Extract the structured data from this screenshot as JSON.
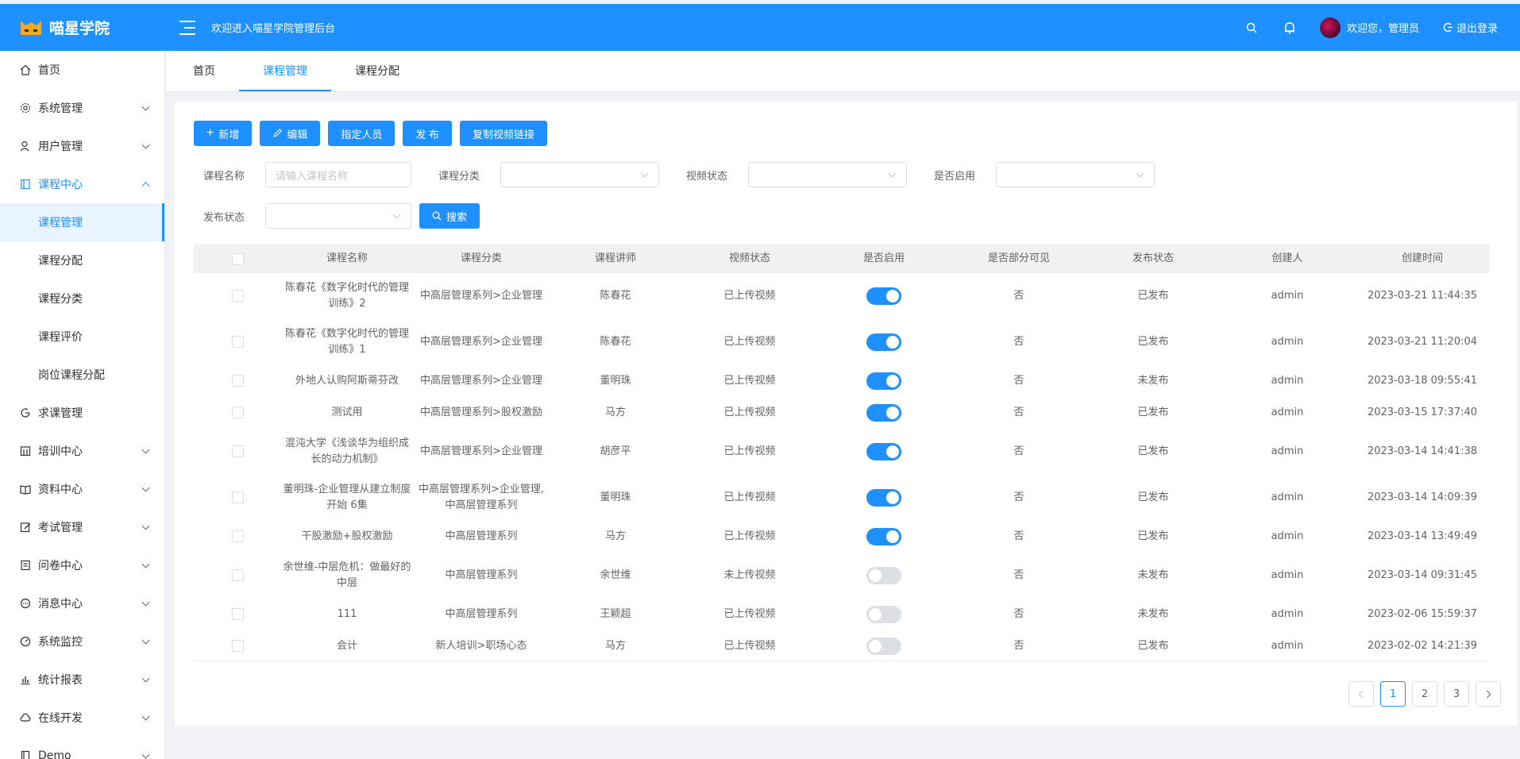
{
  "header": {
    "logo_text": "喵星学院",
    "title": "欢迎进入喵星学院管理后台",
    "greeting": "欢迎您，管理员",
    "logout_label": "退出登录"
  },
  "sidebar": {
    "items": [
      {
        "label": "首页",
        "icon": "home-icon"
      },
      {
        "label": "系统管理",
        "icon": "gear-icon"
      },
      {
        "label": "用户管理",
        "icon": "user-icon"
      },
      {
        "label": "课程中心",
        "icon": "book-icon"
      },
      {
        "label": "课程管理"
      },
      {
        "label": "课程分配"
      },
      {
        "label": "课程分类"
      },
      {
        "label": "课程评价"
      },
      {
        "label": "岗位课程分配"
      },
      {
        "label": "求课管理",
        "icon": "refresh-icon"
      },
      {
        "label": "培训中心",
        "icon": "calendar-icon"
      },
      {
        "label": "资料中心",
        "icon": "book-open-icon"
      },
      {
        "label": "考试管理",
        "icon": "edit-icon"
      },
      {
        "label": "问卷中心",
        "icon": "list-icon"
      },
      {
        "label": "消息中心",
        "icon": "chat-icon"
      },
      {
        "label": "系统监控",
        "icon": "gauge-icon"
      },
      {
        "label": "统计报表",
        "icon": "bar-chart-icon"
      },
      {
        "label": "在线开发",
        "icon": "cloud-icon"
      },
      {
        "label": "Demo",
        "icon": "doc-icon"
      }
    ]
  },
  "tabs": [
    {
      "label": "首页"
    },
    {
      "label": "课程管理"
    },
    {
      "label": "课程分配"
    }
  ],
  "toolbar": {
    "add": "新增",
    "edit": "编辑",
    "assign": "指定人员",
    "publish": "发 布",
    "copy_link": "复制视频链接"
  },
  "filters": {
    "name_label": "课程名称",
    "name_placeholder": "请输入课程名称",
    "category_label": "课程分类",
    "video_label": "视频状态",
    "enabled_label": "是否启用",
    "publish_label": "发布状态",
    "search": "搜索"
  },
  "table": {
    "headers": [
      "课程名称",
      "课程分类",
      "课程讲师",
      "视频状态",
      "是否启用",
      "是否部分可见",
      "发布状态",
      "创建人",
      "创建时间"
    ],
    "rows": [
      {
        "name": "陈春花《数字化时代的管理训练》2",
        "category": "中高层管理系列>企业管理",
        "teacher": "陈春花",
        "video": "已上传视频",
        "enabled": true,
        "partial": "否",
        "publish": "已发布",
        "creator": "admin",
        "time": "2023-03-21 11:44:35"
      },
      {
        "name": "陈春花《数字化时代的管理训练》1",
        "category": "中高层管理系列>企业管理",
        "teacher": "陈春花",
        "video": "已上传视频",
        "enabled": true,
        "partial": "否",
        "publish": "已发布",
        "creator": "admin",
        "time": "2023-03-21 11:20:04"
      },
      {
        "name": "外地人认购阿斯蒂芬改",
        "category": "中高层管理系列>企业管理",
        "teacher": "董明珠",
        "video": "已上传视频",
        "enabled": true,
        "partial": "否",
        "publish": "未发布",
        "creator": "admin",
        "time": "2023-03-18 09:55:41"
      },
      {
        "name": "测试用",
        "category": "中高层管理系列>股权激励",
        "teacher": "马方",
        "video": "已上传视频",
        "enabled": true,
        "partial": "否",
        "publish": "已发布",
        "creator": "admin",
        "time": "2023-03-15 17:37:40"
      },
      {
        "name": "混沌大学《浅谈华为组织成长的动力机制》",
        "category": "中高层管理系列>企业管理",
        "teacher": "胡彦平",
        "video": "已上传视频",
        "enabled": true,
        "partial": "否",
        "publish": "已发布",
        "creator": "admin",
        "time": "2023-03-14 14:41:38"
      },
      {
        "name": "董明珠-企业管理从建立制度开始 6集",
        "category": "中高层管理系列>企业管理,中高层管理系列",
        "teacher": "董明珠",
        "video": "已上传视频",
        "enabled": true,
        "partial": "否",
        "publish": "已发布",
        "creator": "admin",
        "time": "2023-03-14 14:09:39"
      },
      {
        "name": "干股激励+股权激励",
        "category": "中高层管理系列",
        "teacher": "马方",
        "video": "已上传视频",
        "enabled": true,
        "partial": "否",
        "publish": "已发布",
        "creator": "admin",
        "time": "2023-03-14 13:49:49"
      },
      {
        "name": "余世维-中层危机：做最好的中层",
        "category": "中高层管理系列",
        "teacher": "余世维",
        "video": "未上传视频",
        "enabled": false,
        "partial": "否",
        "publish": "未发布",
        "creator": "admin",
        "time": "2023-03-14 09:31:45"
      },
      {
        "name": "111",
        "category": "中高层管理系列",
        "teacher": "王颖超",
        "video": "已上传视频",
        "enabled": false,
        "partial": "否",
        "publish": "未发布",
        "creator": "admin",
        "time": "2023-02-06 15:59:37"
      },
      {
        "name": "会计",
        "category": "新人培训>职场心态",
        "teacher": "马方",
        "video": "已上传视频",
        "enabled": false,
        "partial": "否",
        "publish": "已发布",
        "creator": "admin",
        "time": "2023-02-02 14:21:39"
      }
    ]
  },
  "pagination": {
    "pages": [
      "1",
      "2",
      "3"
    ],
    "current": "1"
  },
  "colors": {
    "primary": "#1e90ff",
    "toggle_off": "#dcdfe6"
  }
}
